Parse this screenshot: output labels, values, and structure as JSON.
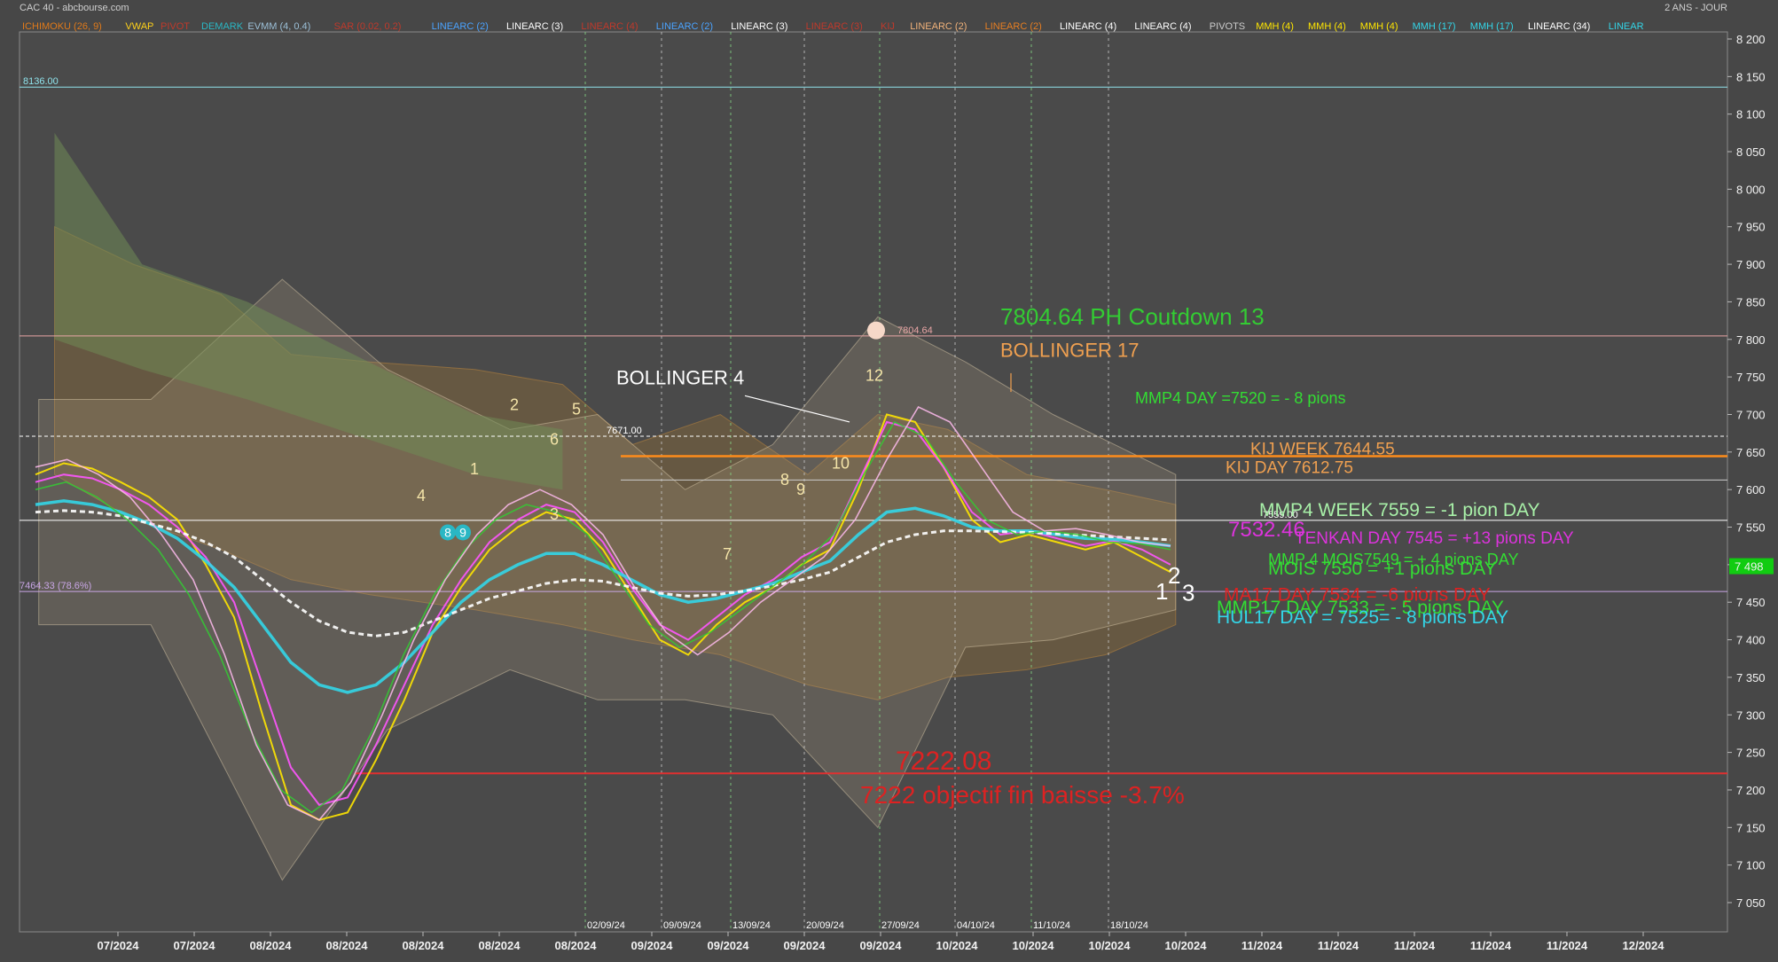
{
  "header": {
    "title": "CAC 40 - abcbourse.com",
    "period": "2 ANS - JOUR"
  },
  "indicators": [
    {
      "label": "ICHIMOKU (26, 9)",
      "color": "#e07a1a"
    },
    {
      "label": "VWAP",
      "color": "#ffd21a"
    },
    {
      "label": "PIVOT",
      "color": "#c0392b"
    },
    {
      "label": "DEMARK",
      "color": "#2ab7c4"
    },
    {
      "label": "EVMM (4, 0.4)",
      "color": "#9cc0d8"
    },
    {
      "label": "SAR (0.02, 0.2)",
      "color": "#c0392b"
    },
    {
      "label": "LINEARC (2)",
      "color": "#4aa3ff"
    },
    {
      "label": "LINEARC (3)",
      "color": "#ffffff"
    },
    {
      "label": "LINEARC (4)",
      "color": "#c0392b"
    },
    {
      "label": "LINEARC (2)",
      "color": "#4aa3ff"
    },
    {
      "label": "LINEARC (3)",
      "color": "#ffffff"
    },
    {
      "label": "LINEARC (3)",
      "color": "#c0392b"
    },
    {
      "label": "KIJ",
      "color": "#c0392b"
    },
    {
      "label": "LINEARC (2)",
      "color": "#f0b27a"
    },
    {
      "label": "LINEARC (2)",
      "color": "#e67e22"
    },
    {
      "label": "LINEARC (4)",
      "color": "#ffffff"
    },
    {
      "label": "LINEARC (4)",
      "color": "#ffffff"
    },
    {
      "label": "PIVOTS",
      "color": "#cccccc"
    },
    {
      "label": "MMH (4)",
      "color": "#ffe600"
    },
    {
      "label": "MMH (4)",
      "color": "#ffe600"
    },
    {
      "label": "MMH (4)",
      "color": "#ffe600"
    },
    {
      "label": "MMH (17)",
      "color": "#33d6e8"
    },
    {
      "label": "MMH (17)",
      "color": "#33d6e8"
    },
    {
      "label": "LINEARC (34)",
      "color": "#ffffff"
    },
    {
      "label": "LINEAR",
      "color": "#33d6e8"
    }
  ],
  "chart_data": {
    "type": "line",
    "y_axis": {
      "ylim": [
        7000,
        8220
      ],
      "ticks": [
        8200,
        8150,
        8100,
        8050,
        8000,
        7950,
        7900,
        7850,
        7800,
        7750,
        7700,
        7650,
        7600,
        7550,
        7500,
        7450,
        7400,
        7350,
        7300,
        7250,
        7200,
        7150,
        7100,
        7050
      ],
      "tick_labels": [
        "8 200",
        "8 150",
        "8 100",
        "8 050",
        "8 000",
        "7 950",
        "7 900",
        "7 850",
        "7 800",
        "7 750",
        "7 700",
        "7 650",
        "7 600",
        "7 550",
        "7 500",
        "7 450",
        "7 400",
        "7 350",
        "7 300",
        "7 250",
        "7 200",
        "7 150",
        "7 100",
        "7 050"
      ],
      "current_label": "7 498",
      "current_value": 7498
    },
    "x_axis": {
      "tick_labels": [
        "07/2024",
        "07/2024",
        "08/2024",
        "08/2024",
        "08/2024",
        "08/2024",
        "08/2024",
        "09/2024",
        "09/2024",
        "09/2024",
        "09/2024",
        "10/2024",
        "10/2024",
        "10/2024",
        "10/2024",
        "11/2024",
        "11/2024",
        "11/2024",
        "11/2024",
        "11/2024",
        "12/2024"
      ],
      "date_markers": [
        "02/09/24",
        "09/09/24",
        "13/09/24",
        "20/09/24",
        "27/09/24",
        "04/10/24",
        "11/10/24",
        "18/10/24"
      ]
    },
    "series": [
      {
        "values": [
          7620,
          7635,
          7628,
          7610,
          7590,
          7560,
          7500,
          7430,
          7300,
          7180,
          7160,
          7170,
          7240,
          7320,
          7410,
          7470,
          7520,
          7550,
          7570,
          7560,
          7520,
          7460,
          7400,
          7380,
          7420,
          7450,
          7470,
          7500,
          7520,
          7600,
          7700,
          7690,
          7630,
          7560,
          7530,
          7540,
          7530,
          7520,
          7530,
          7510,
          7490
        ]
      },
      {
        "values": [
          7610,
          7620,
          7615,
          7600,
          7580,
          7550,
          7510,
          7450,
          7340,
          7230,
          7180,
          7190,
          7260,
          7340,
          7420,
          7480,
          7530,
          7560,
          7580,
          7570,
          7530,
          7470,
          7420,
          7400,
          7430,
          7460,
          7480,
          7510,
          7530,
          7610,
          7690,
          7680,
          7630,
          7570,
          7540,
          7545,
          7535,
          7525,
          7532,
          7520,
          7500
        ]
      },
      {
        "values": [
          7580,
          7585,
          7580,
          7570,
          7555,
          7535,
          7505,
          7470,
          7420,
          7370,
          7340,
          7330,
          7340,
          7370,
          7410,
          7450,
          7480,
          7500,
          7515,
          7515,
          7500,
          7480,
          7460,
          7450,
          7455,
          7465,
          7475,
          7490,
          7505,
          7540,
          7570,
          7575,
          7565,
          7550,
          7545,
          7545,
          7540,
          7535,
          7534,
          7530,
          7525
        ]
      },
      {
        "values": [
          7570,
          7572,
          7570,
          7565,
          7555,
          7545,
          7530,
          7510,
          7480,
          7450,
          7425,
          7410,
          7405,
          7410,
          7425,
          7440,
          7455,
          7465,
          7475,
          7480,
          7478,
          7470,
          7462,
          7458,
          7460,
          7465,
          7472,
          7480,
          7490,
          7510,
          7530,
          7540,
          7545,
          7545,
          7544,
          7543,
          7541,
          7539,
          7537,
          7535,
          7533
        ]
      }
    ],
    "horizontal_levels": [
      {
        "value": 8136,
        "label": "8136.00",
        "color": "#8fe3ec"
      },
      {
        "value": 7804.64,
        "label": "7804.64",
        "color": "#e8a5a5"
      },
      {
        "value": 7671,
        "label": "7671.00",
        "color": "#ffffff"
      },
      {
        "value": 7644.55,
        "label": "",
        "color": "#ff8c1a"
      },
      {
        "value": 7612.75,
        "label": "",
        "color": "#cccccc"
      },
      {
        "value": 7559,
        "label": "7559.00",
        "color": "#ffffff"
      },
      {
        "value": 7464.33,
        "label": "7464.33  (78.6%)",
        "color": "#c9a6e6"
      },
      {
        "value": 7222.08,
        "label": "",
        "color": "#e03030"
      }
    ],
    "annotations": [
      {
        "text": "7804.64 PH Coutdown 13",
        "color": "#33cc33"
      },
      {
        "text": "BOLLINGER 17",
        "color": "#f0a050"
      },
      {
        "text": "BOLLINGER 4",
        "color": "#ffffff"
      },
      {
        "text": "MMP4 DAY =7520 = - 8 pions",
        "color": "#33dd33"
      },
      {
        "text": "KIJ WEEK 7644.55",
        "color": "#f0a050"
      },
      {
        "text": "KIJ DAY 7612.75",
        "color": "#f0a050"
      },
      {
        "text": "MMP4 WEEK 7559 = -1 pion DAY",
        "color": "#a8f0a8"
      },
      {
        "text": "7532.46",
        "color": "#dd33dd"
      },
      {
        "text": "TENKAN DAY 7545 = +13 pions DAY",
        "color": "#dd33dd"
      },
      {
        "text": "MMP 4 MOIS7549 = + 4 pions DAY",
        "color": "#33dd33"
      },
      {
        "text": "MOIS 7550 =  +1 pions DAY",
        "color": "#33dd33"
      },
      {
        "text": "MA17 DAY 7534 = -6 pions DAY",
        "color": "#dd2222"
      },
      {
        "text": "MMP17 DAY 7533 = - 5 pions DAY",
        "color": "#33dd33"
      },
      {
        "text": "HUL17 DAY = 7525= - 8 pions DAY",
        "color": "#33d6e8"
      },
      {
        "text": "7222.08",
        "color": "#dd2222"
      },
      {
        "text": "7222 objectif fin baisse -3.7%",
        "color": "#dd2222"
      }
    ],
    "counts": [
      "1",
      "2",
      "3",
      "4",
      "5",
      "6",
      "7",
      "8",
      "9",
      "10",
      "12"
    ],
    "bubble_counts": [
      "8",
      "9"
    ],
    "wave_labels": [
      "1",
      "2",
      "3"
    ]
  }
}
